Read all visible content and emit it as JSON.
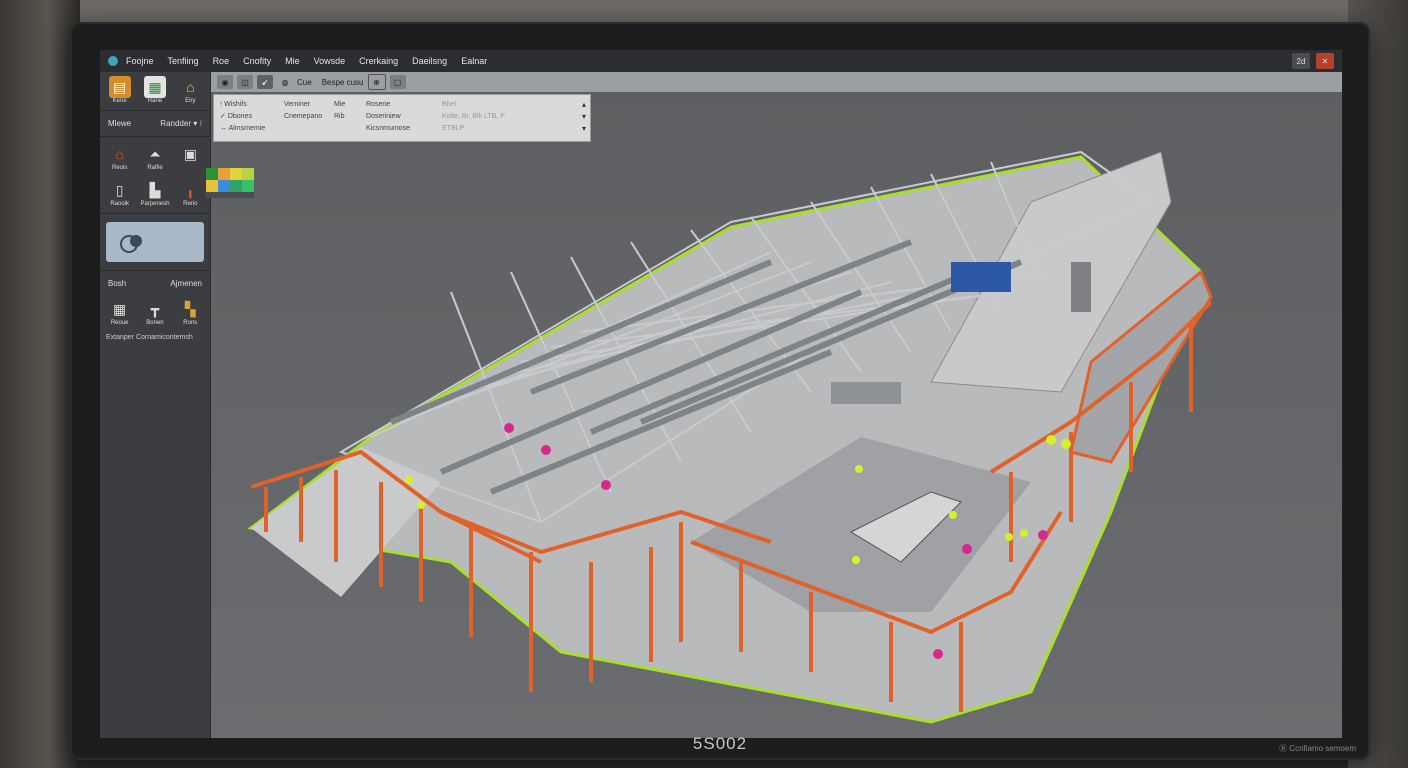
{
  "menu": {
    "items": [
      "Foojne",
      "Tenfiing",
      "Roe",
      "Cnofity",
      "Mie",
      "Vowsde",
      "Crerkaing",
      "Daeilsng",
      "Ealnar"
    ]
  },
  "window_buttons": [
    "2d",
    "✕"
  ],
  "left_panel": {
    "top_tools": [
      {
        "icon": "bars-chart-icon",
        "label": "Kene"
      },
      {
        "icon": "doc-icon",
        "label": "Rane"
      },
      {
        "icon": "house-icon",
        "label": "Eiry"
      }
    ],
    "section1_label": "Mlewe",
    "section1_dropdown": "Randder",
    "mid_tools": [
      {
        "icon": "building-icon",
        "label": "Reois"
      },
      {
        "icon": "arrow-up-icon",
        "label": "Ralfie"
      },
      {
        "icon": "cube-icon",
        "label": ""
      }
    ],
    "mid_tools2": [
      {
        "icon": "door-icon",
        "label": "Raooik"
      },
      {
        "icon": "wall-icon",
        "label": "Parpenesh"
      },
      {
        "icon": "pin-icon",
        "label": "Rerio"
      }
    ],
    "section2_label": "Bosh",
    "section2_label2": "Ajmenen",
    "bottom_tools": [
      {
        "icon": "grid-icon",
        "label": "Reoue"
      },
      {
        "icon": "tee-icon",
        "label": "Bonen"
      },
      {
        "icon": "block-icon",
        "label": "Rons"
      }
    ],
    "footer": "Extanper Cornamicontemsh"
  },
  "vtoolbar": {
    "label1": "Cue",
    "label2": "Bespe cusu"
  },
  "properties": {
    "col1": [
      "Wishifs",
      "Dbones",
      "Almsmemie"
    ],
    "col2": [
      "",
      "Verniner",
      "Cnemepano"
    ],
    "col3": [
      "",
      "Mie",
      "Rib"
    ],
    "col4": [
      "Rosene",
      "Doseriniew",
      "Kicsnmumose"
    ],
    "col5": [
      "Bbel",
      "Kolte, Br, Blk LTB, P",
      "ETBLP"
    ]
  },
  "monitor_brand": "5S002",
  "bezel_badge": "Ⓡ Ccnfiamo semoem",
  "colors": {
    "steel": "#e0622b",
    "ground_edge": "#a6e02a",
    "marker_magenta": "#d6268f",
    "marker_yellow": "#d8f02b",
    "roof": "#c8c9ca"
  }
}
